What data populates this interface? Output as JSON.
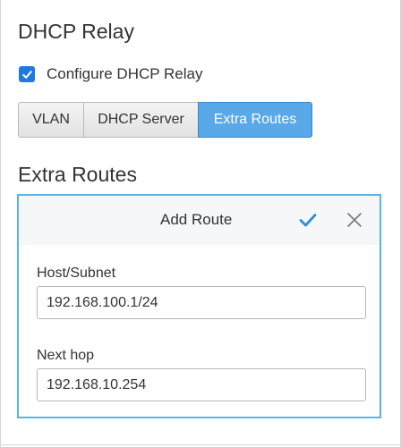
{
  "dhcp_relay": {
    "title": "DHCP Relay",
    "configure_checkbox": {
      "label": "Configure DHCP Relay",
      "checked": true
    }
  },
  "tabs": [
    {
      "label": "VLAN",
      "active": false
    },
    {
      "label": "DHCP Server",
      "active": false
    },
    {
      "label": "Extra Routes",
      "active": true
    }
  ],
  "extra_routes": {
    "title": "Extra Routes",
    "add_route": {
      "title": "Add Route",
      "confirm_icon": "checkmark-icon",
      "close_icon": "close-icon",
      "host_subnet": {
        "label": "Host/Subnet",
        "value": "192.168.100.1/24",
        "placeholder": ""
      },
      "next_hop": {
        "label": "Next hop",
        "value": "192.168.10.254",
        "placeholder": ""
      }
    }
  },
  "colors": {
    "accent": "#1f7ae0",
    "active_tab": "#59a8e8",
    "box_border": "#58b4e4",
    "text": "#333333"
  }
}
